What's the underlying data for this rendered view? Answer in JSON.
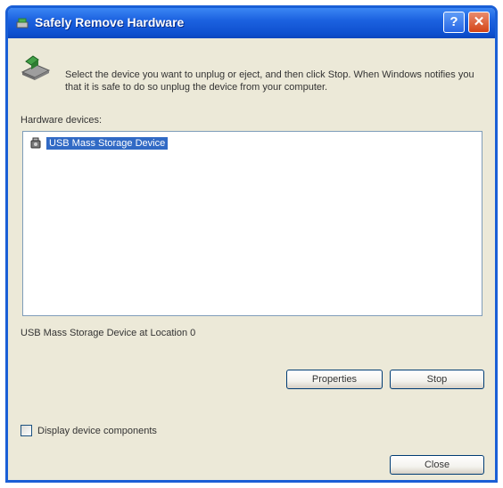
{
  "window": {
    "title": "Safely Remove Hardware",
    "help_glyph": "?",
    "close_glyph": "✕"
  },
  "instruction": "Select the device you want to unplug or eject, and then click Stop. When Windows notifies you that it is safe to do so unplug the device from your computer.",
  "hardware_devices": {
    "label": "Hardware devices:",
    "items": [
      {
        "label": "USB Mass Storage Device",
        "selected": true
      }
    ]
  },
  "location_text": "USB Mass Storage Device at Location 0",
  "buttons": {
    "properties": "Properties",
    "stop": "Stop",
    "close": "Close"
  },
  "display_components": {
    "label": "Display device components",
    "checked": false
  },
  "colors": {
    "titlebar": "#0e50cf",
    "selection": "#316ac5",
    "face": "#ece9d8"
  }
}
